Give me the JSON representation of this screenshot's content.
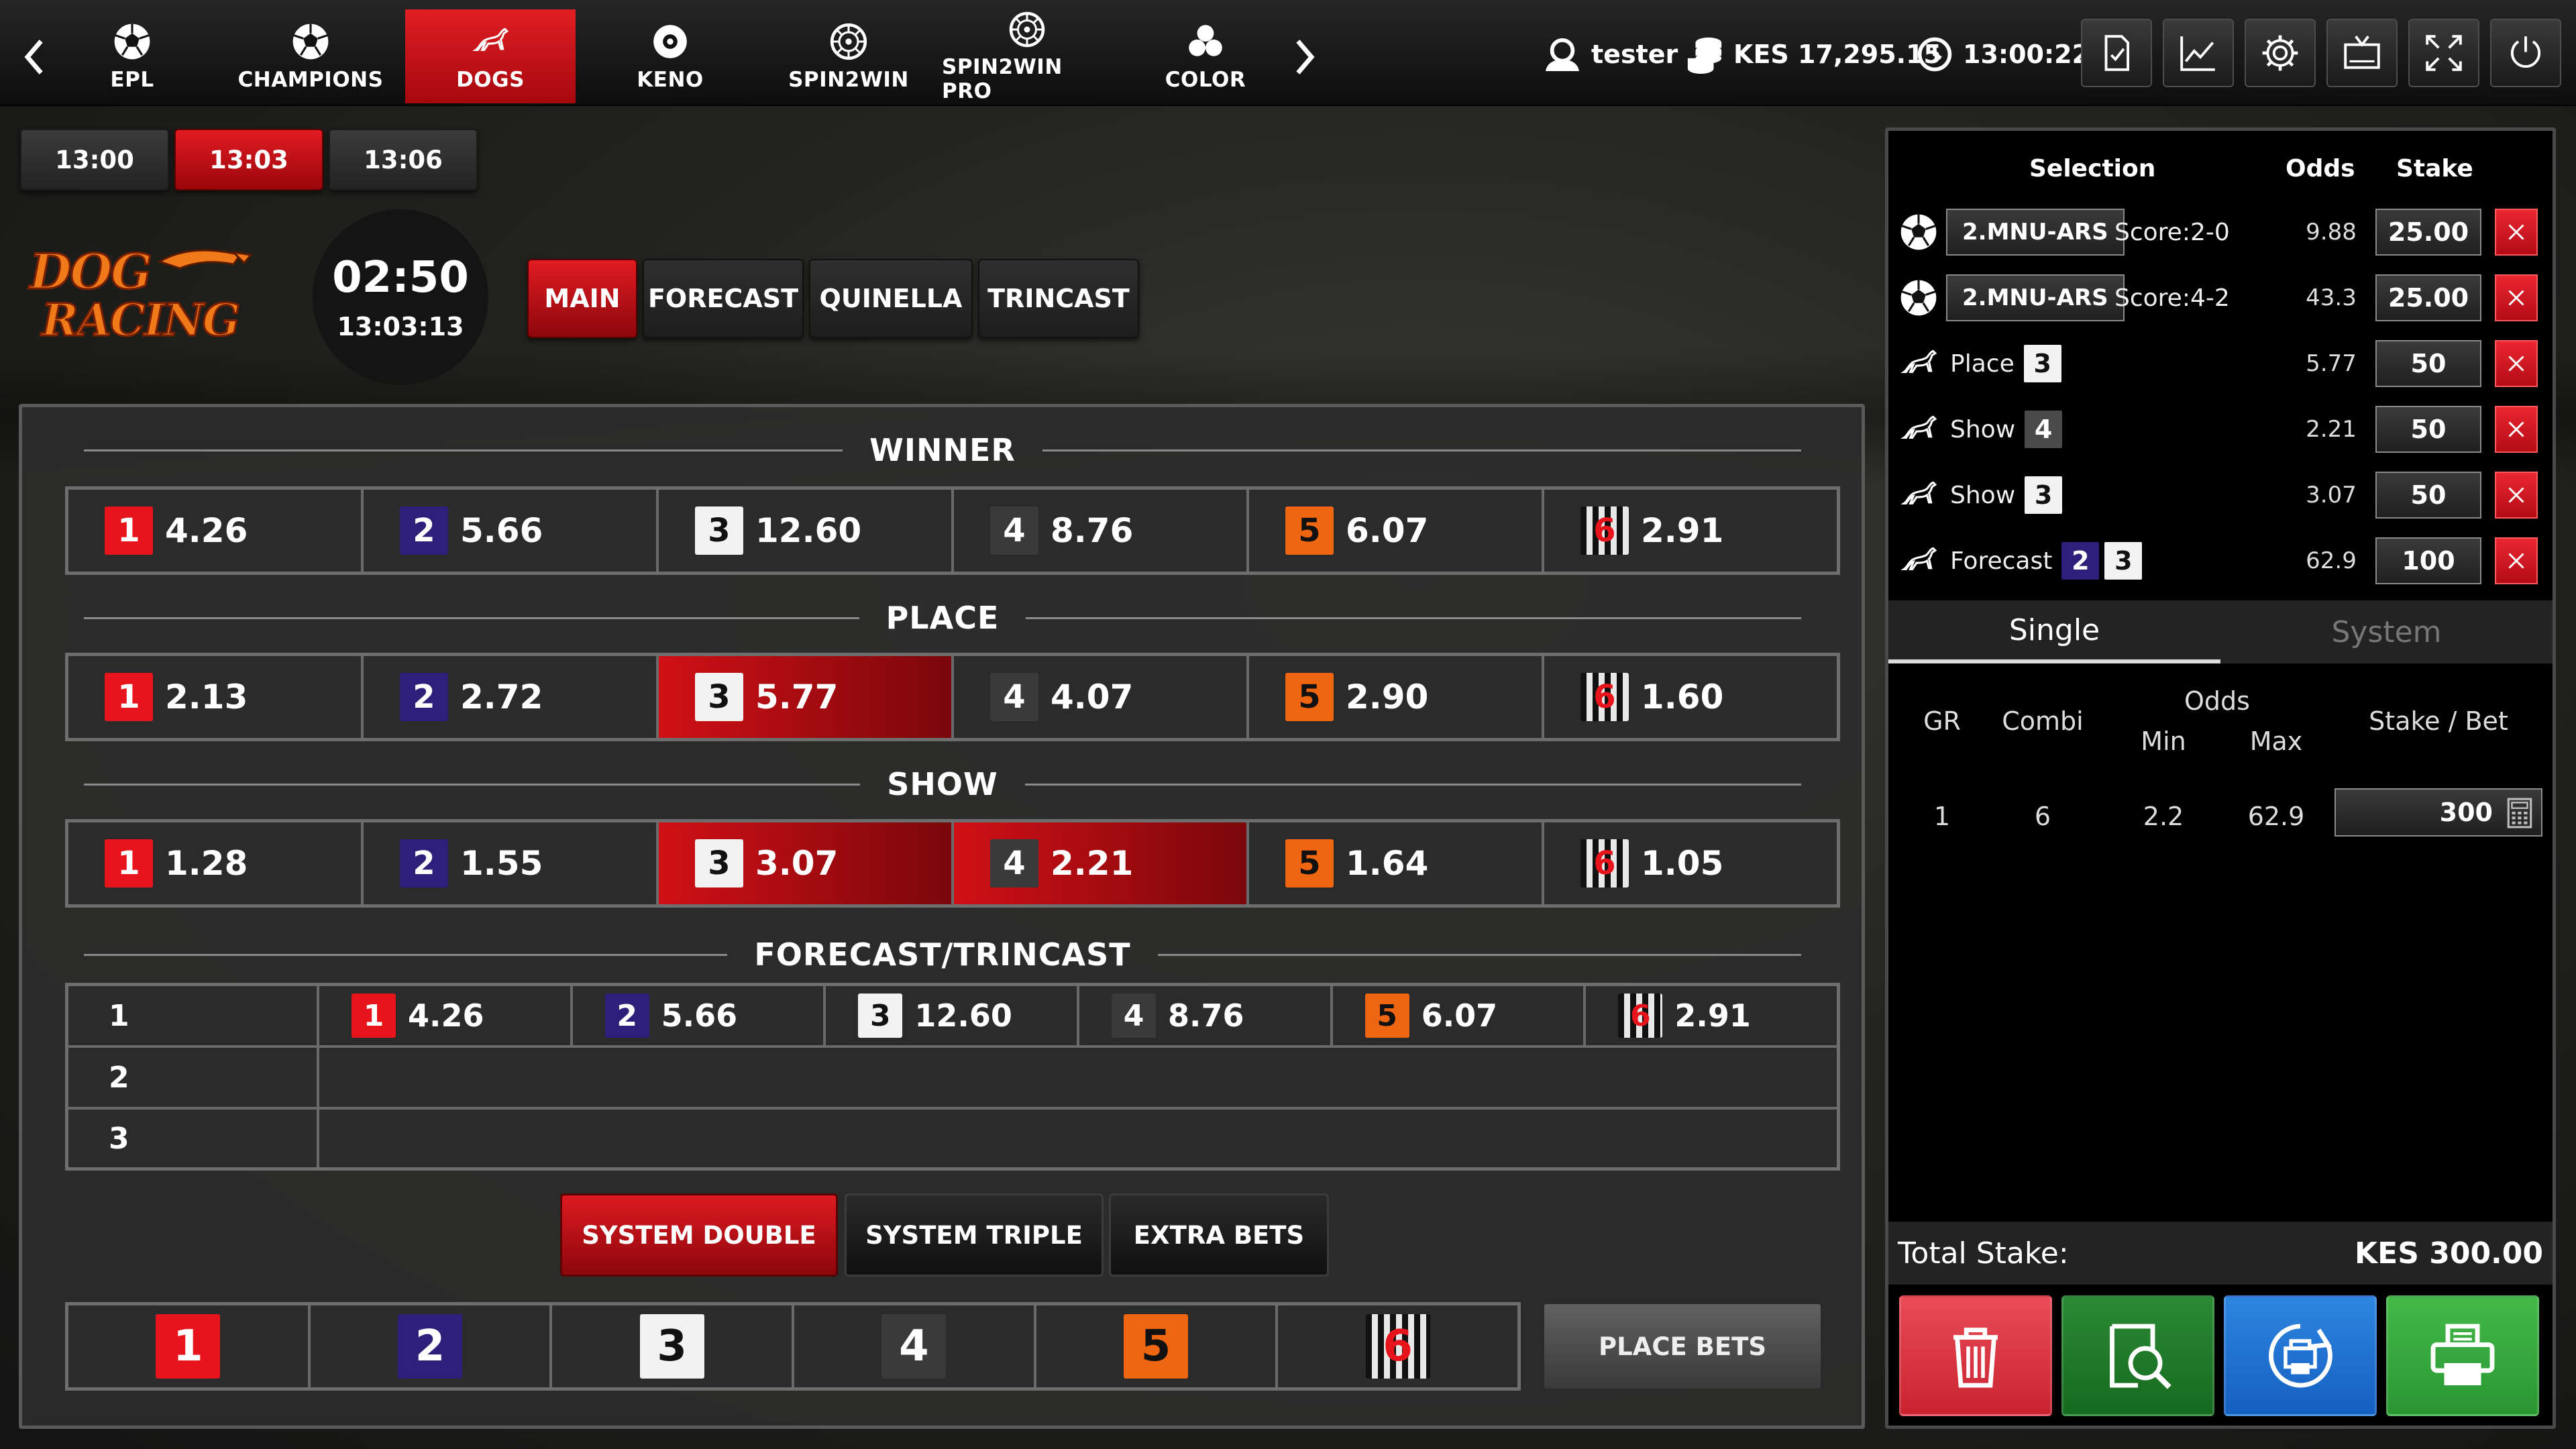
{
  "nav": {
    "items": [
      {
        "label": "EPL",
        "icon": "soccer-ball-icon"
      },
      {
        "label": "CHAMPIONS",
        "icon": "soccer-ball-icon"
      },
      {
        "label": "DOGS",
        "icon": "greyhound-icon",
        "active": true
      },
      {
        "label": "KENO",
        "icon": "keno-ball-icon"
      },
      {
        "label": "SPIN2WIN",
        "icon": "roulette-wheel-icon"
      },
      {
        "label": "SPIN2WIN PRO",
        "icon": "roulette-wheel-icon"
      },
      {
        "label": "COLOR",
        "icon": "color-balls-icon"
      }
    ]
  },
  "user": {
    "name": "tester",
    "balance": "KES 17,295.15",
    "clock": "13:00:22"
  },
  "toolbar": {
    "icons": [
      "ticket-check-icon",
      "stats-chart-icon",
      "settings-gear-icon",
      "tv-icon",
      "fullscreen-icon",
      "power-icon"
    ]
  },
  "rounds": [
    {
      "label": "13:00"
    },
    {
      "label": "13:03",
      "active": true
    },
    {
      "label": "13:06"
    }
  ],
  "logo": {
    "line1": "DOG",
    "line2": "RACING"
  },
  "timer": {
    "countdown": "02:50",
    "race_time": "13:03:13"
  },
  "market_tabs": [
    {
      "label": "MAIN",
      "active": true
    },
    {
      "label": "FORECAST"
    },
    {
      "label": "QUINELLA"
    },
    {
      "label": "TRINCAST"
    }
  ],
  "sections": {
    "winner": "WINNER",
    "place": "PLACE",
    "show": "SHOW",
    "forecast": "FORECAST/TRINCAST"
  },
  "traps": [
    "1",
    "2",
    "3",
    "4",
    "5",
    "6"
  ],
  "winner": [
    "4.26",
    "5.66",
    "12.60",
    "8.76",
    "6.07",
    "2.91"
  ],
  "place": [
    "2.13",
    "2.72",
    "5.77",
    "4.07",
    "2.90",
    "1.60"
  ],
  "place_selected": [
    3
  ],
  "show": [
    "1.28",
    "1.55",
    "3.07",
    "2.21",
    "1.64",
    "1.05"
  ],
  "show_selected": [
    3,
    4
  ],
  "forecast": {
    "rows": [
      "1",
      "2",
      "3"
    ],
    "row1": [
      "4.26",
      "5.66",
      "12.60",
      "8.76",
      "6.07",
      "2.91"
    ]
  },
  "system_tabs": [
    {
      "label": "SYSTEM DOUBLE",
      "active": true
    },
    {
      "label": "SYSTEM TRIPLE"
    },
    {
      "label": "EXTRA BETS"
    }
  ],
  "place_bets_label": "PLACE BETS",
  "betslip": {
    "headers": {
      "selection": "Selection",
      "odds": "Odds",
      "stake": "Stake"
    },
    "items": [
      {
        "icon": "soccer-ball-icon",
        "tag": "2.MNU-ARS",
        "desc": "Score:2-0",
        "odds": "9.88",
        "stake": "25.00"
      },
      {
        "icon": "soccer-ball-icon",
        "tag": "2.MNU-ARS",
        "desc": "Score:4-2",
        "odds": "43.3",
        "stake": "25.00"
      },
      {
        "icon": "greyhound-icon",
        "desc": "Place",
        "nums": [
          "3"
        ],
        "odds": "5.77",
        "stake": "50"
      },
      {
        "icon": "greyhound-icon",
        "desc": "Show",
        "nums": [
          "4"
        ],
        "odds": "2.21",
        "stake": "50"
      },
      {
        "icon": "greyhound-icon",
        "desc": "Show",
        "nums": [
          "3"
        ],
        "odds": "3.07",
        "stake": "50"
      },
      {
        "icon": "greyhound-icon",
        "desc": "Forecast",
        "nums": [
          "2",
          "3"
        ],
        "odds": "62.9",
        "stake": "100"
      }
    ],
    "tabs": {
      "single": "Single",
      "system": "System"
    },
    "summary_headers": {
      "gr": "GR",
      "combi": "Combi",
      "odds": "Odds",
      "min": "Min",
      "max": "Max",
      "stake_bet": "Stake / Bet"
    },
    "summary": {
      "gr": "1",
      "combi": "6",
      "min": "2.2",
      "max": "62.9",
      "stake_bet": "300"
    },
    "total_label": "Total Stake:",
    "total_value": "KES 300.00",
    "actions": [
      "delete-icon",
      "search-ticket-icon",
      "reprint-icon",
      "print-icon"
    ]
  },
  "colors": {
    "accent": "#c3121a",
    "trap1": "#e8141b",
    "trap2": "#2e1f7a",
    "trap3": "#f2f2f2",
    "trap4": "#3a3a3a",
    "trap5": "#ef6612",
    "delete": "#d8323e",
    "search": "#1f7f2a",
    "reprint": "#1a6fd1",
    "print": "#34a83a"
  }
}
